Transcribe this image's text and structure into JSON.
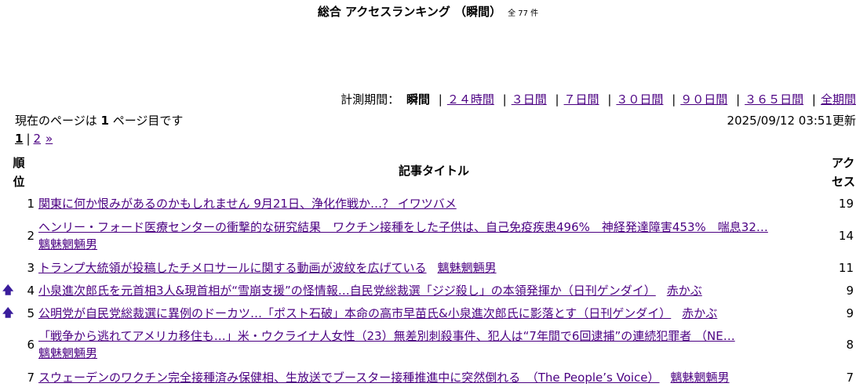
{
  "header": {
    "title": "総合 アクセスランキング （瞬間）",
    "total": "全 77 件"
  },
  "period": {
    "label": "計測期間：",
    "current": "瞬間",
    "links": [
      "２４時間",
      "３日間",
      "７日間",
      "３０日間",
      "９０日間",
      "３６５日間",
      "全期間"
    ]
  },
  "page_info": {
    "prefix": "現在のページは",
    "page": "1",
    "suffix": "ページ目です"
  },
  "updated": "2025/09/12 03:51更新",
  "pager": {
    "current": "1",
    "other": "2",
    "next": "»"
  },
  "table": {
    "headers": {
      "rank_line1": "順",
      "rank_line2": "位",
      "title": "記事タイトル",
      "access_line1": "アク",
      "access_line2": "セス"
    },
    "rows": [
      {
        "rank": "1",
        "title": "関東に何か恨みがあるのかもしれません 9月21日、浄化作戦か…？ イワツバメ",
        "author": "",
        "count": "19",
        "arrow": ""
      },
      {
        "rank": "2",
        "title": "ヘンリー・フォード医療センターの衝撃的な研究結果　ワクチン接種をした子供は、自己免疫疾患496%　神経発達障害453%　喘息32…",
        "author": "魑魅魍魎男",
        "count": "14",
        "arrow": ""
      },
      {
        "rank": "3",
        "title": "トランプ大統領が投稿したチメロサールに関する動画が波紋を広げている",
        "author": "魑魅魍魎男",
        "count": "11",
        "arrow": ""
      },
      {
        "rank": "4",
        "title": "小泉進次郎氏を元首相3人&現首相が“雪崩支援”の怪情報…自民党総裁選「ジジ殺し」の本領発揮か（日刊ゲンダイ）",
        "author": "赤かぶ",
        "count": "9",
        "arrow": "🡅"
      },
      {
        "rank": "5",
        "title": "公明党が自民党総裁選に異例のドーカツ…「ポスト石破」本命の高市早苗氏&小泉進次郎氏に影落とす（日刊ゲンダイ）",
        "author": "赤かぶ",
        "count": "9",
        "arrow": "🡅"
      },
      {
        "rank": "6",
        "title": "「戦争から逃れてアメリカ移住も…」米・ウクライナ人女性（23）無差別刺殺事件、犯人は“7年間で6回逮捕”の連続犯罪者 （NE…",
        "author": "魑魅魍魎男",
        "count": "8",
        "arrow": ""
      },
      {
        "rank": "7",
        "title": "スウェーデンのワクチン完全接種済み保健相、生放送でブースター接種推進中に突然倒れる　（The People’s Voice）",
        "author": "魑魅魍魎男",
        "count": "7",
        "arrow": ""
      }
    ]
  }
}
